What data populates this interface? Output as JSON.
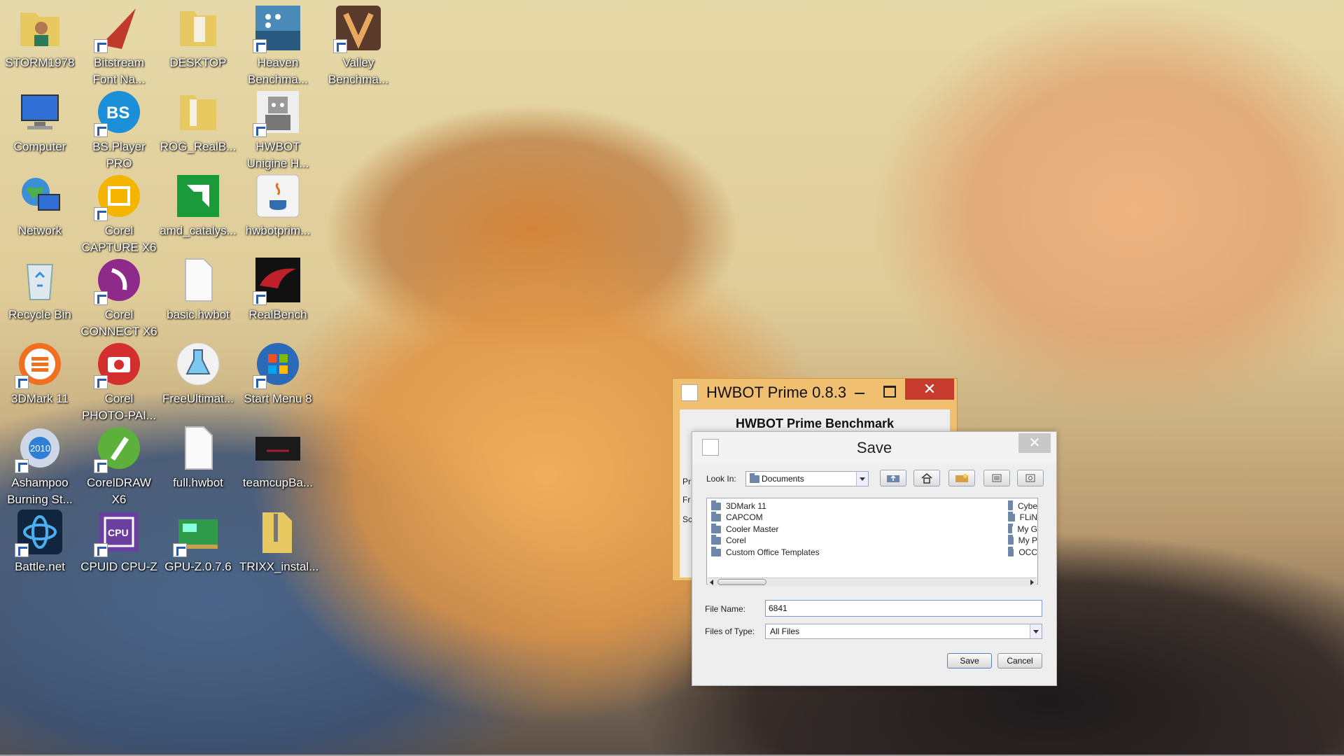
{
  "desktop": {
    "icons": [
      {
        "label": "STORM1978"
      },
      {
        "label": "Bitstream\nFont Na..."
      },
      {
        "label": "DESKTOP"
      },
      {
        "label": "Heaven\nBenchma..."
      },
      {
        "label": "Valley\nBenchma..."
      },
      {
        "label": "Computer"
      },
      {
        "label": "BS.Player\nPRO"
      },
      {
        "label": "ROG_RealB..."
      },
      {
        "label": "HWBOT\nUnigine H..."
      },
      {
        "label": "Network"
      },
      {
        "label": "Corel\nCAPTURE X6"
      },
      {
        "label": "amd_catalys..."
      },
      {
        "label": "hwbotprim..."
      },
      {
        "label": "Recycle Bin"
      },
      {
        "label": "Corel\nCONNECT X6"
      },
      {
        "label": "basic.hwbot"
      },
      {
        "label": "RealBench"
      },
      {
        "label": "3DMark 11"
      },
      {
        "label": "Corel\nPHOTO-PAI..."
      },
      {
        "label": "FreeUltimat..."
      },
      {
        "label": "Start Menu 8"
      },
      {
        "label": "Ashampoo\nBurning St..."
      },
      {
        "label": "CorelDRAW\nX6"
      },
      {
        "label": "full.hwbot"
      },
      {
        "label": "teamcupBa..."
      },
      {
        "label": "Battle.net"
      },
      {
        "label": "CPUID CPU-Z"
      },
      {
        "label": "GPU-Z.0.7.6"
      },
      {
        "label": "TRIXX_instal..."
      }
    ]
  },
  "hwbot_window": {
    "title": "HWBOT Prime 0.8.3",
    "close_label": "✕",
    "bench_title": "HWBOT Prime Benchmark",
    "side_labels": [
      "Pr",
      "Fr",
      "Sc"
    ]
  },
  "save_dialog": {
    "title": "Save",
    "close_label": "✕",
    "look_in_label": "Look In:",
    "look_in_value": "Documents",
    "files_left": [
      "3DMark 11",
      "CAPCOM",
      "Cooler Master",
      "Corel",
      "Custom Office Templates"
    ],
    "files_right": [
      "Cybe",
      "FLiN",
      "My G",
      "My P",
      "OCC"
    ],
    "file_name_label": "File Name:",
    "file_name_value": "6841",
    "files_of_type_label": "Files of Type:",
    "files_of_type_value": "All Files",
    "save_label": "Save",
    "cancel_label": "Cancel"
  },
  "colors": {
    "hwbot_frame": "#f0c070",
    "close_red": "#c73b2f",
    "dialog_bg": "#eeeeee"
  }
}
